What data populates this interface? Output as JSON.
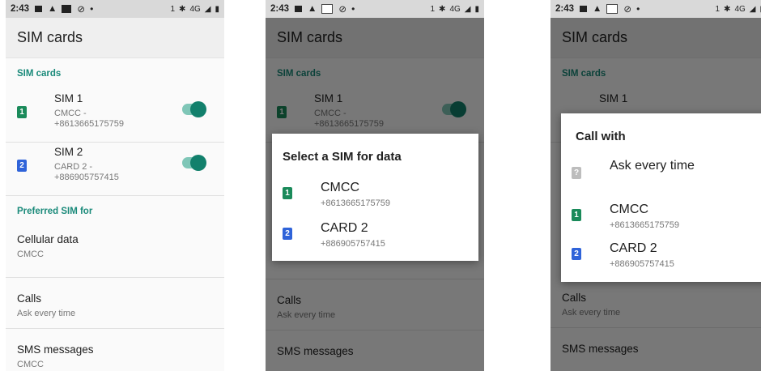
{
  "status": {
    "time": "2:43",
    "network": "4G",
    "sim_icon": "1"
  },
  "screen": {
    "title": "SIM cards",
    "section_sims": "SIM cards",
    "sims": [
      {
        "badge": "1",
        "name": "SIM 1",
        "carrier": "CMCC -",
        "number": "+8613665175759",
        "enabled": true
      },
      {
        "badge": "2",
        "name": "SIM 2",
        "carrier": "CARD 2 -",
        "number": "+886905757415",
        "enabled": true
      }
    ],
    "section_pref": "Preferred SIM for",
    "prefs": [
      {
        "title": "Cellular data",
        "value": "CMCC"
      },
      {
        "title": "Calls",
        "value": "Ask every time"
      },
      {
        "title": "SMS messages",
        "value": "CMCC"
      }
    ]
  },
  "dialog_data": {
    "title": "Select a SIM for data",
    "options": [
      {
        "badge": "1",
        "name": "CMCC",
        "number": "+8613665175759"
      },
      {
        "badge": "2",
        "name": "CARD 2",
        "number": "+886905757415"
      }
    ]
  },
  "dialog_call": {
    "title": "Call with",
    "ask_label": "Ask every time",
    "options": [
      {
        "badge": "1",
        "name": "CMCC",
        "number": "+8613665175759"
      },
      {
        "badge": "2",
        "name": "CARD 2",
        "number": "+886905757415"
      }
    ]
  },
  "colors": {
    "accent": "#12806c",
    "sim1": "#1a8a5a",
    "sim2": "#2f63d9"
  }
}
